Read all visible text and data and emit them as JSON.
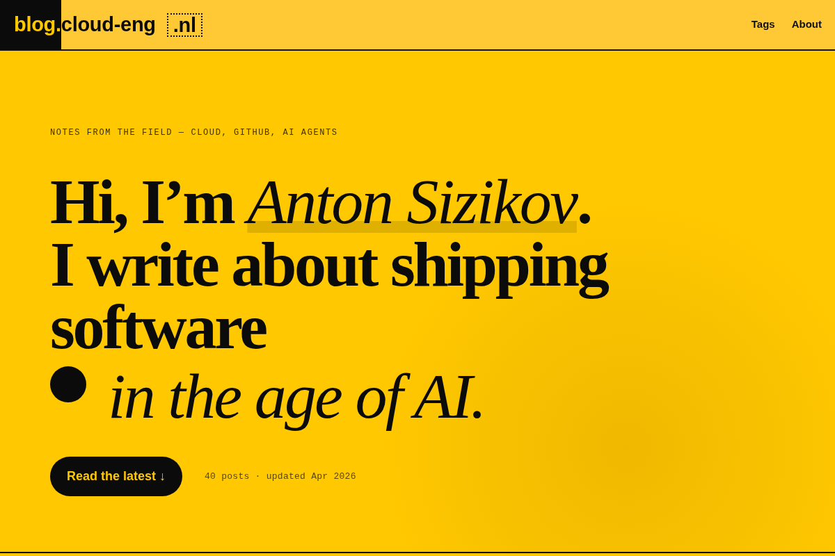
{
  "header": {
    "logo": {
      "prefix": "blog.",
      "name": "cloud-eng",
      "tld": ".nl"
    },
    "nav": [
      {
        "label": "Tags"
      },
      {
        "label": "About"
      }
    ]
  },
  "hero": {
    "eyebrow": "NOTES FROM THE FIELD — CLOUD, GITHUB, AI AGENTS",
    "headline": [
      {
        "text": "Hi, I’m *Anton Sizikov*.",
        "italic": false,
        "dot": false
      },
      {
        "text": "I write about shipping software",
        "italic": false,
        "dot": false
      },
      {
        "text": "in the age of AI.",
        "italic": true,
        "dot": true
      }
    ],
    "cta": {
      "label": "Read the latest ↓"
    },
    "meta": "40 posts · updated Apr 2026"
  }
}
